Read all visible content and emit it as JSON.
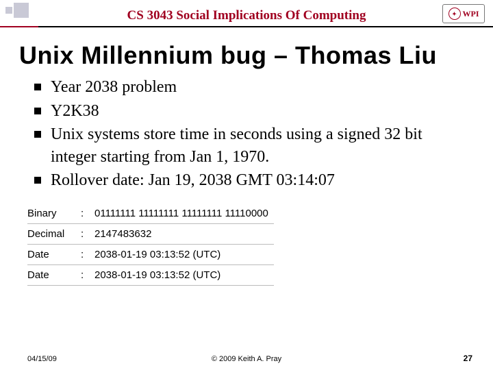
{
  "header": {
    "course_title": "CS 3043 Social Implications Of Computing",
    "logo_text": "WPI"
  },
  "slide": {
    "title": "Unix Millennium bug – Thomas Liu",
    "bullets": [
      "Year 2038 problem",
      "Y2K38",
      "Unix systems store time in seconds using a signed 32 bit integer starting from Jan 1, 1970.",
      "Rollover date: Jan 19, 2038 GMT 03:14:07"
    ]
  },
  "table": {
    "rows": [
      {
        "label": "Binary",
        "value": "01111111 11111111 11111111 11110000"
      },
      {
        "label": "Decimal",
        "value": "2147483632"
      },
      {
        "label": "Date",
        "value": "2038-01-19 03:13:52 (UTC)"
      },
      {
        "label": "Date",
        "value": "2038-01-19 03:13:52 (UTC)"
      }
    ],
    "sep": ":"
  },
  "footer": {
    "date": "04/15/09",
    "copyright": "© 2009 Keith A. Pray",
    "page": "27"
  }
}
